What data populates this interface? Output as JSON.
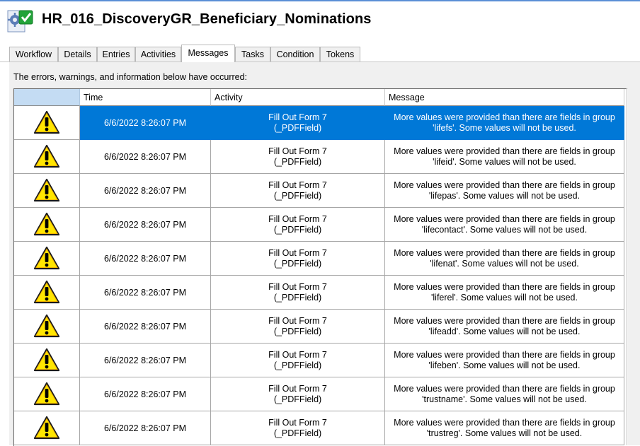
{
  "window": {
    "title": "HR_016_DiscoveryGR_Beneficiary_Nominations",
    "icon": "workflow-gear-check-icon",
    "accent": "#0078d7"
  },
  "tabs": [
    {
      "label": "Workflow",
      "active": false
    },
    {
      "label": "Details",
      "active": false
    },
    {
      "label": "Entries",
      "active": false
    },
    {
      "label": "Activities",
      "active": false
    },
    {
      "label": "Messages",
      "active": true
    },
    {
      "label": "Tasks",
      "active": false
    },
    {
      "label": "Condition",
      "active": false
    },
    {
      "label": "Tokens",
      "active": false
    }
  ],
  "panel": {
    "intro": "The errors, warnings, and information below have occurred:"
  },
  "grid": {
    "columns": [
      "",
      "Time",
      "Activity",
      "Message"
    ],
    "warning_icon": "warning-triangle-icon",
    "rows": [
      {
        "time": "6/6/2022 8:26:07 PM",
        "activity_line1": "Fill Out Form 7",
        "activity_line2": "(_PDFField)",
        "message_line1": "More values were provided than there are fields in group",
        "message_line2": "'lifefs'.  Some values will not be used.",
        "selected": true
      },
      {
        "time": "6/6/2022 8:26:07 PM",
        "activity_line1": "Fill Out Form 7",
        "activity_line2": "(_PDFField)",
        "message_line1": "More values were provided than there are fields in group",
        "message_line2": "'lifeid'.  Some values will not be used.",
        "selected": false
      },
      {
        "time": "6/6/2022 8:26:07 PM",
        "activity_line1": "Fill Out Form 7",
        "activity_line2": "(_PDFField)",
        "message_line1": "More values were provided than there are fields in group",
        "message_line2": "'lifepas'.  Some values will not be used.",
        "selected": false
      },
      {
        "time": "6/6/2022 8:26:07 PM",
        "activity_line1": "Fill Out Form 7",
        "activity_line2": "(_PDFField)",
        "message_line1": "More values were provided than there are fields in group",
        "message_line2": "'lifecontact'.  Some values will not be used.",
        "selected": false
      },
      {
        "time": "6/6/2022 8:26:07 PM",
        "activity_line1": "Fill Out Form 7",
        "activity_line2": "(_PDFField)",
        "message_line1": "More values were provided than there are fields in group",
        "message_line2": "'lifenat'.  Some values will not be used.",
        "selected": false
      },
      {
        "time": "6/6/2022 8:26:07 PM",
        "activity_line1": "Fill Out Form 7",
        "activity_line2": "(_PDFField)",
        "message_line1": "More values were provided than there are fields in group",
        "message_line2": "'liferel'.  Some values will not be used.",
        "selected": false
      },
      {
        "time": "6/6/2022 8:26:07 PM",
        "activity_line1": "Fill Out Form 7",
        "activity_line2": "(_PDFField)",
        "message_line1": "More values were provided than there are fields in group",
        "message_line2": "'lifeadd'.  Some values will not be used.",
        "selected": false
      },
      {
        "time": "6/6/2022 8:26:07 PM",
        "activity_line1": "Fill Out Form 7",
        "activity_line2": "(_PDFField)",
        "message_line1": "More values were provided than there are fields in group",
        "message_line2": "'lifeben'.  Some values will not be used.",
        "selected": false
      },
      {
        "time": "6/6/2022 8:26:07 PM",
        "activity_line1": "Fill Out Form 7",
        "activity_line2": "(_PDFField)",
        "message_line1": "More values were provided than there are fields in group",
        "message_line2": "'trustname'.  Some values will not be used.",
        "selected": false
      },
      {
        "time": "6/6/2022 8:26:07 PM",
        "activity_line1": "Fill Out Form 7",
        "activity_line2": "(_PDFField)",
        "message_line1": "More values were provided than there are fields in group",
        "message_line2": "'trustreg'.  Some values will not be used.",
        "selected": false
      }
    ]
  }
}
